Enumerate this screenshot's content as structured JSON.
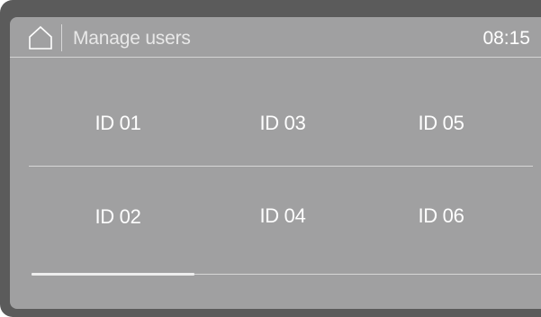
{
  "header": {
    "home_icon": "home-icon",
    "title": "Manage users",
    "time": "08:15"
  },
  "users": {
    "row1": [
      "ID 01",
      "ID 03",
      "ID 05"
    ],
    "row2": [
      "ID 02",
      "ID 04",
      "ID 06"
    ]
  },
  "pagination": {
    "current_page": 1,
    "total_pages": 3
  },
  "colors": {
    "screen_background": "#a0a0a1",
    "bezel": "#5b5b5b",
    "text": "#ffffff"
  }
}
